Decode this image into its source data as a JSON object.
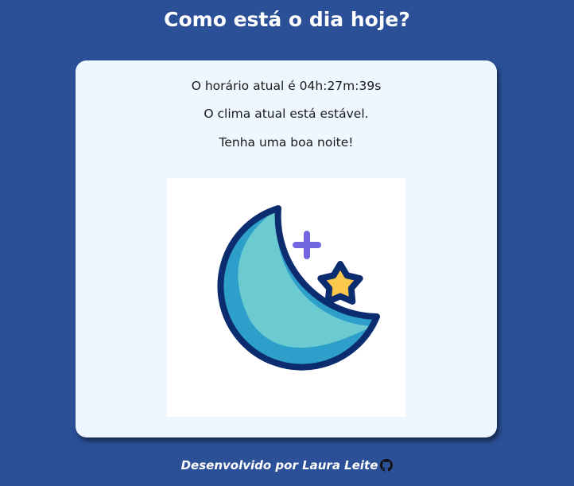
{
  "page": {
    "title": "Como está o dia hoje?"
  },
  "card": {
    "time_text": "O horário atual é 04h:27m:39s",
    "weather_text": "O clima atual está estável.",
    "greeting_text": "Tenha uma boa noite!",
    "image_icon": "moon-star-icon"
  },
  "footer": {
    "credit": "Desenvolvido por Laura Leite",
    "link_icon": "github-icon"
  },
  "colors": {
    "background": "#2b5097",
    "card": "#eef6ff",
    "moon_dark": "#2e9ecb",
    "moon_light": "#6bcbd0",
    "outline": "#0b2c6e",
    "star": "#fcc84c",
    "plus": "#7266e0"
  }
}
